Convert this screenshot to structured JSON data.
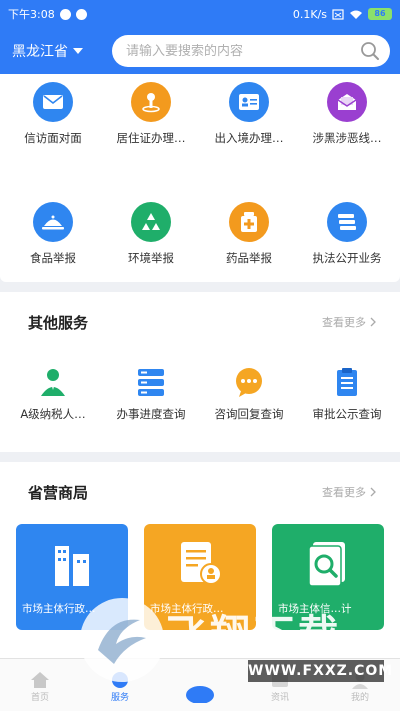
{
  "status_bar": {
    "time": "下午3:08",
    "net_speed": "0.1K/s",
    "battery": "86"
  },
  "header": {
    "province": "黑龙江省",
    "search_placeholder": "请输入要搜索的内容"
  },
  "services_row1": [
    {
      "label": "信访面对面",
      "icon": "mail-icon",
      "color": "#2f86f0"
    },
    {
      "label": "居住证办理…",
      "icon": "person-pin-icon",
      "color": "#f39a1e"
    },
    {
      "label": "出入境办理…",
      "icon": "id-card-icon",
      "color": "#2f86f0"
    },
    {
      "label": "涉黑涉恶线…",
      "icon": "envelope-open-icon",
      "color": "#9a3fd0"
    }
  ],
  "services_row2": [
    {
      "label": "食品举报",
      "icon": "food-tray-icon",
      "color": "#2f86f0"
    },
    {
      "label": "环境举报",
      "icon": "recycle-icon",
      "color": "#1fae6a"
    },
    {
      "label": "药品举报",
      "icon": "medicine-box-icon",
      "color": "#f39a1e"
    },
    {
      "label": "执法公开业务",
      "icon": "stack-icon",
      "color": "#2f86f0"
    }
  ],
  "other_services": {
    "title": "其他服务",
    "more": "查看更多",
    "items": [
      {
        "label": "A级纳税人…",
        "icon": "taxpayer-icon"
      },
      {
        "label": "办事进度查询",
        "icon": "list-progress-icon"
      },
      {
        "label": "咨询回复查询",
        "icon": "chat-bubble-icon"
      },
      {
        "label": "审批公示查询",
        "icon": "clipboard-icon"
      }
    ]
  },
  "provincial": {
    "title": "省营商局",
    "more": "查看更多",
    "tiles": [
      {
        "label": "市场主体行政…",
        "color": "#2f86f0",
        "icon": "building-icon"
      },
      {
        "label": "市场主体行政…",
        "color": "#f5a623",
        "icon": "document-person-icon"
      },
      {
        "label": "市场主体信…计",
        "color": "#1fae6a",
        "icon": "magnify-document-icon"
      }
    ]
  },
  "tabs": [
    {
      "label": "首页",
      "icon": "home-icon"
    },
    {
      "label": "服务",
      "icon": "service-icon"
    },
    {
      "label": "",
      "icon": "center-icon"
    },
    {
      "label": "资讯",
      "icon": "news-icon"
    },
    {
      "label": "我的",
      "icon": "profile-icon"
    }
  ],
  "watermark": {
    "title": "飞翔下载",
    "url": "WWW.FXXZ.COM"
  }
}
